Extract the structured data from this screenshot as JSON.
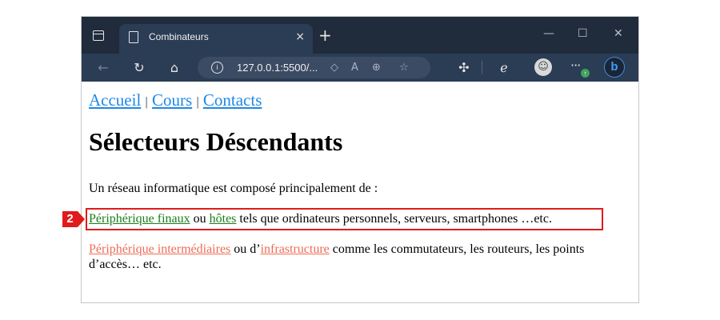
{
  "browser": {
    "tab_title": "Combinateurs",
    "tab_close_glyph": "×",
    "new_tab_glyph": "+",
    "window_controls": {
      "minimize": "—",
      "maximize": "☐",
      "close": "✕"
    },
    "url": "127.0.0.1:5500/...",
    "nav_icons": {
      "back": "back-arrow-icon",
      "refresh": "refresh-icon",
      "home": "home-icon",
      "info": "info-icon",
      "tracking": "tracking-icon",
      "read_aloud": "read-aloud-icon",
      "zoom": "zoom-icon",
      "favorites": "add-favorite-icon",
      "extensions": "extensions-icon",
      "collections": "collections-icon",
      "profile": "profile-avatar",
      "more": "more-icon",
      "copilot": "bing-copilot-icon"
    },
    "notification_badge": "↑",
    "colors": {
      "titlebar": "#202b3b",
      "toolbar": "#2b3c55",
      "address": "#3b4b64"
    }
  },
  "page": {
    "nav": {
      "link_1": "Accueil",
      "sep_1": "|",
      "link_2": "Cours",
      "sep_2": "|",
      "link_3": "Contacts"
    },
    "heading": "Sélecteurs Déscendants",
    "intro": "Un réseau informatique est composé principalement de :",
    "line_2": {
      "link_a": "Périphérique finaux",
      "mid": " ou ",
      "link_b": "hôtes",
      "rest": " tels que ordinateurs personnels, serveurs, smartphones …etc."
    },
    "line_3": {
      "link_a": "Périphérique intermédiaires",
      "mid": " ou d’",
      "link_b": "infrastructure",
      "rest": " comme les commutateurs, les routeurs, les points d’accès… etc."
    },
    "colors": {
      "nav_link": "#1e88e5",
      "green_link": "#1b7d1b",
      "salmon_link": "#f06b55"
    }
  },
  "annotation": {
    "step_number": "2",
    "color": "#e01b1b"
  }
}
